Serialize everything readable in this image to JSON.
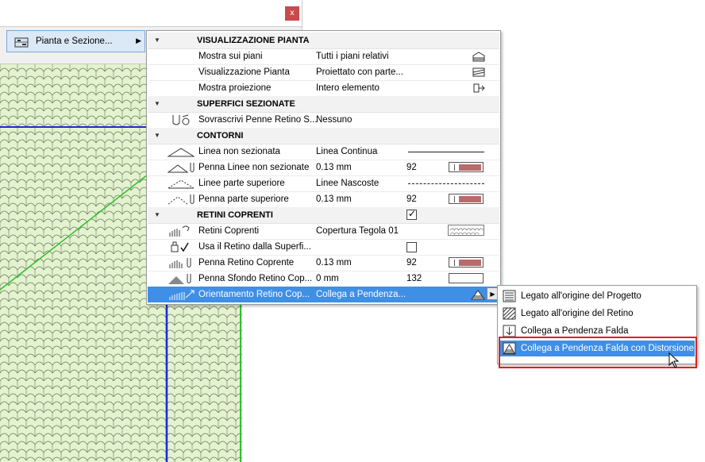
{
  "dialog": {
    "close_label": "x"
  },
  "nav_menu": {
    "item_label": "Pianta e Sezione..."
  },
  "sections": {
    "visualizzazione": "VISUALIZZAZIONE PIANTA",
    "superfici": "SUPERFICI SEZIONATE",
    "contorni": "CONTORNI",
    "retini": "RETINI COPRENTI"
  },
  "rows": {
    "mostra_piani": {
      "name": "Mostra sui piani",
      "value": "Tutti i piani relativi"
    },
    "visualizzazione": {
      "name": "Visualizzazione Pianta",
      "value": "Proiettato con parte..."
    },
    "proiezione": {
      "name": "Mostra proiezione",
      "value": "Intero elemento"
    },
    "sovrascrivi": {
      "name": "Sovrascrivi Penne Retino S...",
      "value": "Nessuno"
    },
    "linea_non_sez": {
      "name": "Linea non sezionata",
      "value": "Linea Continua"
    },
    "penna_linee_non_sez": {
      "name": "Penna Linee non sezionate",
      "value": "0.13 mm",
      "pen": "92"
    },
    "linee_sup": {
      "name": "Linee parte superiore",
      "value": "Linee Nascoste"
    },
    "penna_sup": {
      "name": "Penna parte superiore",
      "value": "0.13 mm",
      "pen": "92"
    },
    "retini_coprenti": {
      "name": "Retini Coprenti",
      "value": "Copertura Tegola 01"
    },
    "usa_retino": {
      "name": "Usa il Retino dalla Superfi..."
    },
    "penna_retino": {
      "name": "Penna Retino Coprente",
      "value": "0.13 mm",
      "pen": "92"
    },
    "penna_sfondo": {
      "name": "Penna Sfondo Retino Cop...",
      "value": "0 mm",
      "pen": "132"
    },
    "orientamento": {
      "name": "Orientamento Retino Cop...",
      "value": "Collega a Pendenza..."
    }
  },
  "submenu": [
    {
      "label": "Legato all'origine del Progetto",
      "icon": "project-origin-icon"
    },
    {
      "label": "Legato all'origine del Retino",
      "icon": "fill-origin-icon"
    },
    {
      "label": "Collega a Pendenza Falda",
      "icon": "link-slope-icon"
    },
    {
      "label": "Collega a Pendenza Falda con Distorsione",
      "icon": "link-slope-distortion-icon"
    }
  ],
  "colors": {
    "selection": "#3f8fe6",
    "highlight_box": "#e02020",
    "pen_swatch": "#b86b6b",
    "canvas_fill": "#e3f2cf",
    "blue_line": "#1a2bd6",
    "green_line": "#2fbf2f"
  }
}
